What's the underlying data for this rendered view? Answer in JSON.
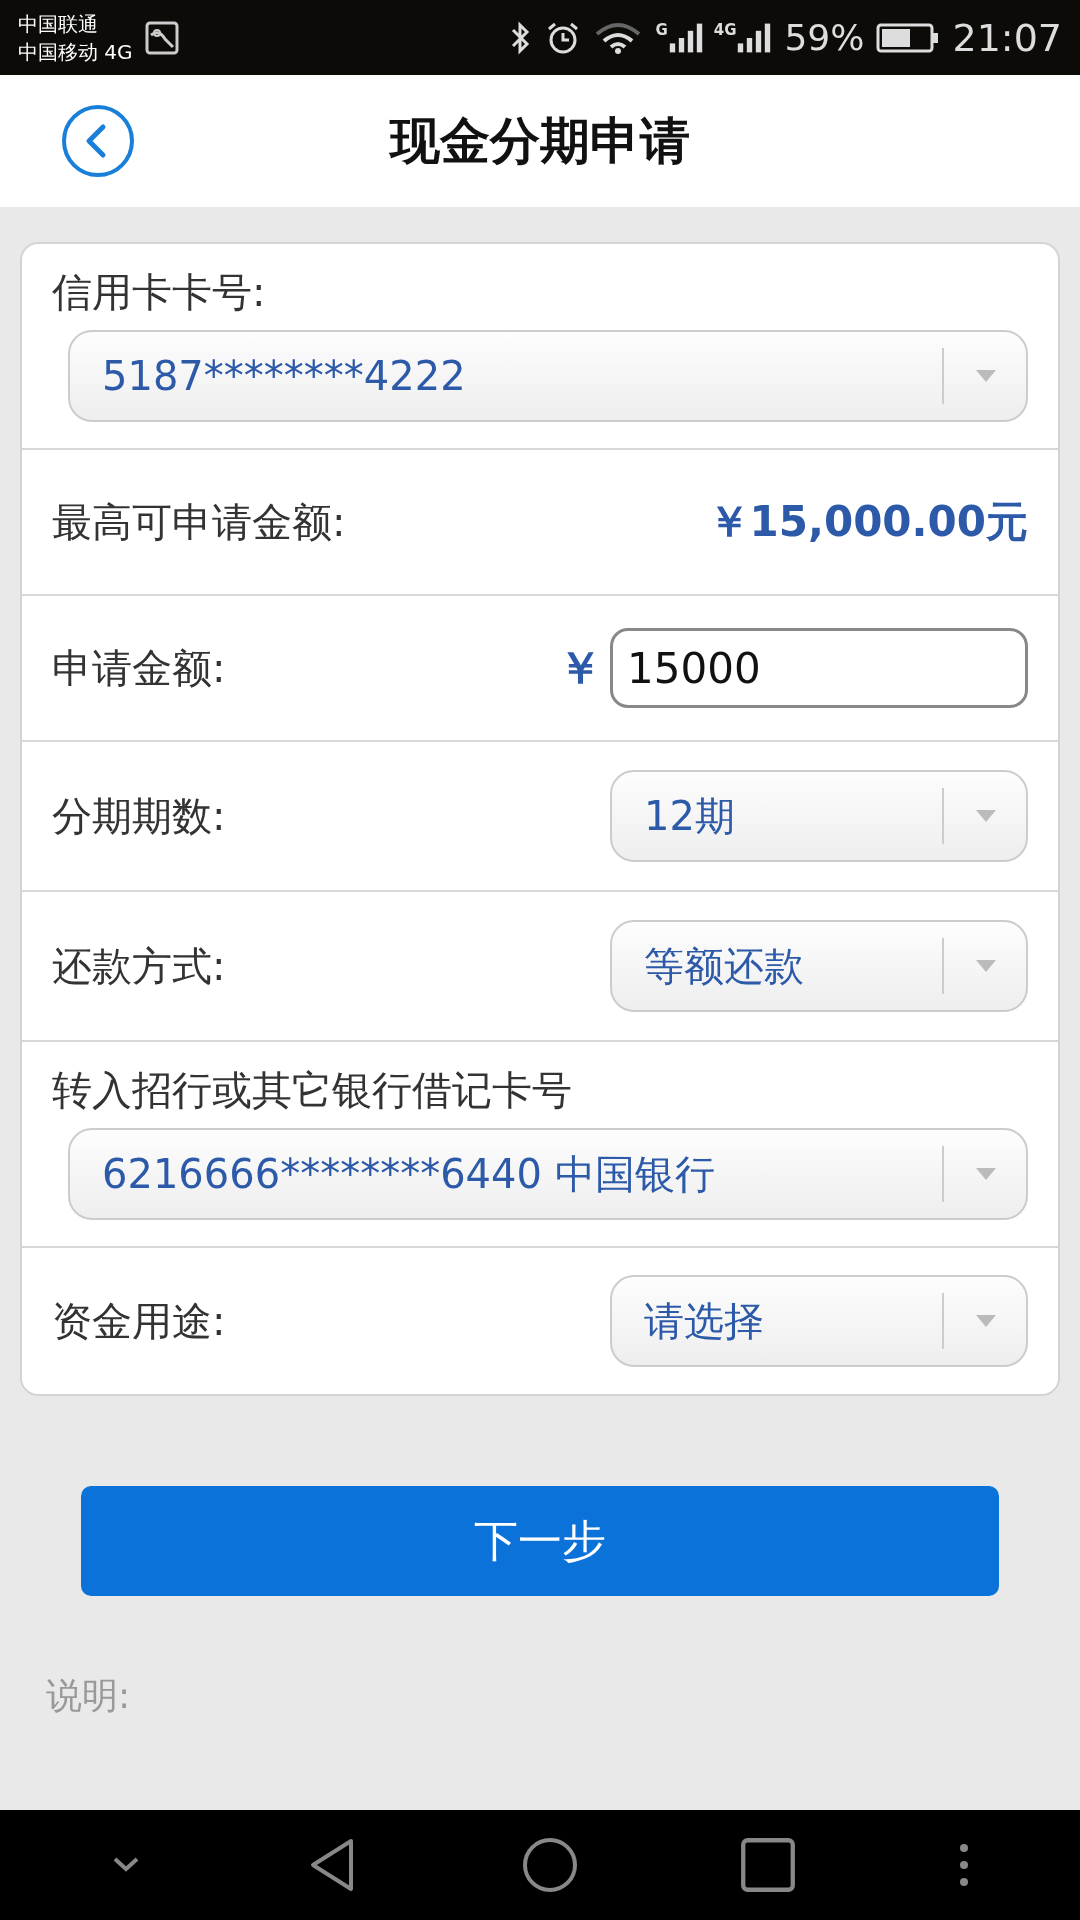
{
  "status_bar": {
    "carriers": [
      "中国联通",
      "中国移动 4G"
    ],
    "signals": [
      "G",
      "4G"
    ],
    "battery": "59%",
    "time": "21:07"
  },
  "header": {
    "title": "现金分期申请"
  },
  "fields": [
    {
      "kind": "select_block",
      "label": "信用卡卡号:",
      "value": "5187********4222"
    },
    {
      "kind": "value",
      "label": "最高可申请金额:",
      "value": "￥15,000.00元"
    },
    {
      "kind": "input",
      "label": "申请金额:",
      "prefix": "￥",
      "value": "15000"
    },
    {
      "kind": "select_inline",
      "label": "分期期数:",
      "value": "12期"
    },
    {
      "kind": "select_inline",
      "label": "还款方式:",
      "value": "等额还款"
    },
    {
      "kind": "select_block",
      "label": "转入招行或其它银行借记卡号",
      "value": "6216666********6440 中国银行"
    },
    {
      "kind": "select_inline",
      "label": "资金用途:",
      "value": "请选择"
    }
  ],
  "next_button": "下一步",
  "note": "说明:"
}
